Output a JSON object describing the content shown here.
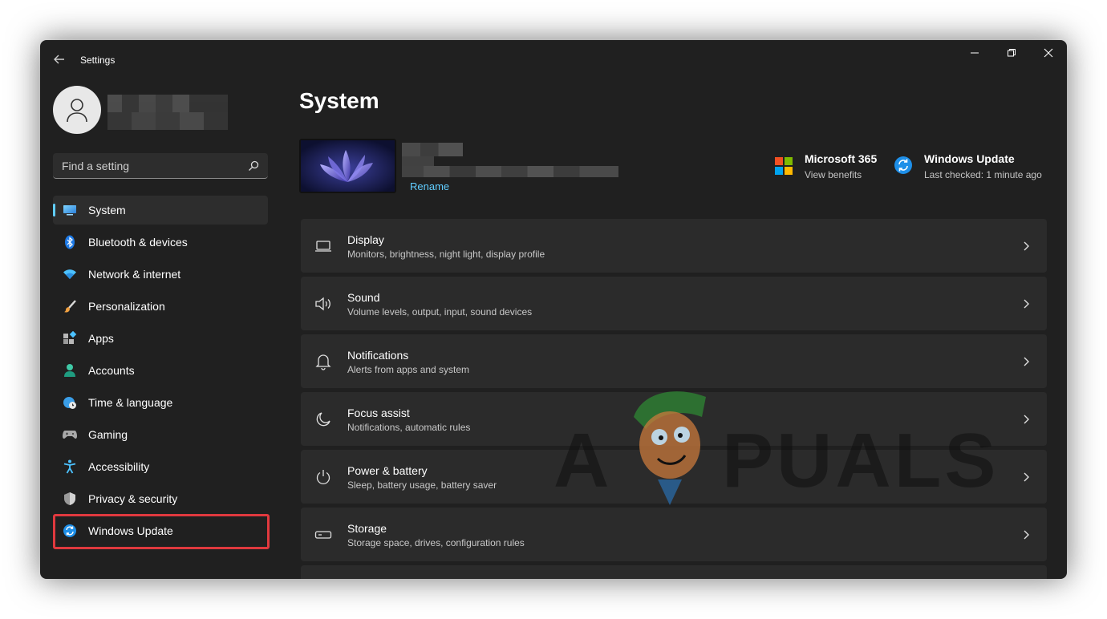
{
  "window": {
    "title": "Settings",
    "controls": {
      "minimize": "minimize-icon",
      "maximize": "restore-icon",
      "close": "close-icon"
    }
  },
  "search": {
    "placeholder": "Find a setting"
  },
  "sidebar": {
    "items": [
      {
        "label": "System",
        "icon": "system-display-icon",
        "active": true
      },
      {
        "label": "Bluetooth & devices",
        "icon": "bluetooth-icon"
      },
      {
        "label": "Network & internet",
        "icon": "wifi-icon"
      },
      {
        "label": "Personalization",
        "icon": "brush-icon"
      },
      {
        "label": "Apps",
        "icon": "apps-icon"
      },
      {
        "label": "Accounts",
        "icon": "person-icon"
      },
      {
        "label": "Time & language",
        "icon": "globe-clock-icon"
      },
      {
        "label": "Gaming",
        "icon": "gamepad-icon"
      },
      {
        "label": "Accessibility",
        "icon": "accessibility-icon"
      },
      {
        "label": "Privacy & security",
        "icon": "shield-icon"
      },
      {
        "label": "Windows Update",
        "icon": "sync-icon",
        "highlighted": true
      }
    ]
  },
  "main": {
    "title": "System",
    "device": {
      "rename_label": "Rename"
    },
    "microsoft365": {
      "title": "Microsoft 365",
      "subtitle": "View benefits"
    },
    "windows_update": {
      "title": "Windows Update",
      "subtitle": "Last checked: 1 minute ago"
    },
    "cards": [
      {
        "title": "Display",
        "subtitle": "Monitors, brightness, night light, display profile",
        "icon": "monitor-icon"
      },
      {
        "title": "Sound",
        "subtitle": "Volume levels, output, input, sound devices",
        "icon": "speaker-icon"
      },
      {
        "title": "Notifications",
        "subtitle": "Alerts from apps and system",
        "icon": "bell-icon"
      },
      {
        "title": "Focus assist",
        "subtitle": "Notifications, automatic rules",
        "icon": "moon-icon"
      },
      {
        "title": "Power & battery",
        "subtitle": "Sleep, battery usage, battery saver",
        "icon": "power-icon"
      },
      {
        "title": "Storage",
        "subtitle": "Storage space, drives, configuration rules",
        "icon": "drive-icon"
      }
    ]
  },
  "watermark": {
    "text": "APPUALS"
  },
  "colors": {
    "accent": "#60cdff",
    "highlight_box": "#e0393e",
    "window_bg": "#202020",
    "card_bg": "#2b2b2b"
  }
}
